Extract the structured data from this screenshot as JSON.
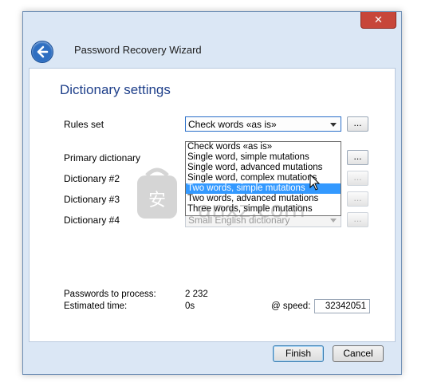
{
  "window": {
    "close_label": "✕",
    "title": "Password Recovery Wizard"
  },
  "section_title": "Dictionary settings",
  "rules_set": {
    "label": "Rules set",
    "value": "Check words «as is»",
    "browse": "..."
  },
  "dropdown_options": [
    "Check words «as is»",
    "Single word, simple mutations",
    "Single word, advanced mutations",
    "Single word, complex mutations",
    "Two words, simple mutations",
    "Two words, advanced mutations",
    "Three words, simple mutations"
  ],
  "dropdown_selected_index": 4,
  "primary_dictionary": {
    "label": "Primary dictionary",
    "browse": "..."
  },
  "dictionary2": {
    "label": "Dictionary #2",
    "browse": "..."
  },
  "dictionary3": {
    "label": "Dictionary #3",
    "browse": "..."
  },
  "dictionary4": {
    "label": "Dictionary #4",
    "value": "Small English dictionary",
    "browse": "..."
  },
  "stats": {
    "passwords_label": "Passwords to process:",
    "passwords_value": "2 232",
    "time_label": "Estimated time:",
    "time_value": "0s",
    "speed_label": "@ speed:",
    "speed_value": "32342051"
  },
  "buttons": {
    "finish": "Finish",
    "cancel": "Cancel"
  },
  "watermark": {
    "text": "anxz.com"
  },
  "colors": {
    "title": "#1e3f8a",
    "selection": "#3399ff",
    "close": "#c7463a"
  }
}
